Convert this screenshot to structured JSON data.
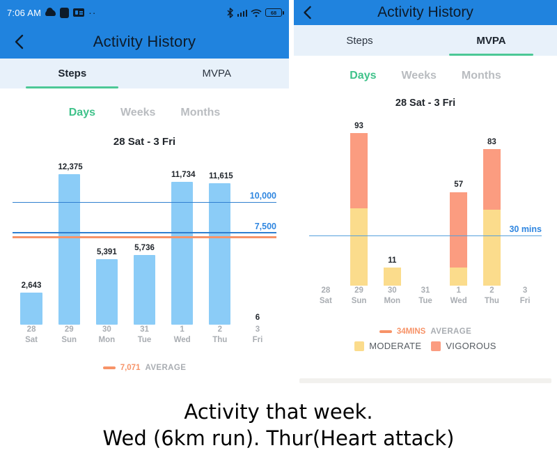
{
  "left_phone": {
    "status_bar": {
      "time": "7:06 AM",
      "icons": [
        "cloud-icon",
        "square-icon",
        "card-icon",
        "dots-icon"
      ],
      "right_icons": [
        "bluetooth-icon",
        "signal-icon",
        "wifi-icon",
        "battery-icon"
      ],
      "battery_level": "68"
    },
    "app_bar": {
      "title": "Activity History",
      "back": "back-chevron-icon"
    },
    "tabs": [
      {
        "label": "Steps",
        "active": true
      },
      {
        "label": "MVPA",
        "active": false
      }
    ],
    "periods": [
      {
        "label": "Days",
        "active": true
      },
      {
        "label": "Weeks",
        "active": false
      },
      {
        "label": "Months",
        "active": false
      }
    ],
    "range_title": "28 Sat  -  3 Fri",
    "legend": {
      "value": "7,071",
      "word": "AVERAGE"
    }
  },
  "right_phone": {
    "app_bar": {
      "title": "Activity History",
      "back": "back-chevron-icon"
    },
    "tabs": [
      {
        "label": "Steps",
        "active": false
      },
      {
        "label": "MVPA",
        "active": true
      }
    ],
    "periods": [
      {
        "label": "Days",
        "active": true
      },
      {
        "label": "Weeks",
        "active": false
      },
      {
        "label": "Months",
        "active": false
      }
    ],
    "range_title": "28 Sat  -  3 Fri",
    "legend_average": {
      "value": "34MINS",
      "word": "AVERAGE"
    },
    "legend_series": [
      {
        "label": "MODERATE",
        "color": "#FBDC8C"
      },
      {
        "label": "VIGOROUS",
        "color": "#FB9C80"
      }
    ]
  },
  "caption": {
    "line1": "Activity that week.",
    "line2": "Wed (6km run). Thur(Heart attack)"
  },
  "colors": {
    "header_blue": "#2083DE",
    "tabbar_bg": "#E8F1FA",
    "tab_accent_green": "#4CC896",
    "period_active_green": "#3FC28A",
    "bar_blue": "#8BCCF7",
    "goal_line_blue": "#2F7FD0",
    "average_orange": "#F79368",
    "moderate_yellow": "#FBDC8C",
    "vigorous_salmon": "#FB9C80"
  },
  "chart_data": [
    {
      "type": "bar",
      "title": "28 Sat  -  3 Fri",
      "subtitle": "Steps",
      "xlabel": "",
      "ylabel": "Steps",
      "ylim": [
        0,
        13500
      ],
      "grid": false,
      "legend_position": "bottom",
      "categories": [
        "28 Sat",
        "29 Sun",
        "30 Mon",
        "31 Tue",
        "1 Wed",
        "2 Thu",
        "3 Fri"
      ],
      "tick_day_numbers": [
        "28",
        "29",
        "30",
        "31",
        "1",
        "2",
        "3"
      ],
      "tick_day_names": [
        "Sat",
        "Sun",
        "Mon",
        "Tue",
        "Wed",
        "Thu",
        "Fri"
      ],
      "values": [
        2643,
        12375,
        5391,
        5736,
        11734,
        11615,
        6
      ],
      "data_labels": [
        "2,643",
        "12,375",
        "5,391",
        "5,736",
        "11,734",
        "11,615",
        "6"
      ],
      "bar_color": "#8BCCF7",
      "reference_lines": [
        {
          "label": "10,000",
          "value": 10000,
          "color": "#2F7FD0"
        },
        {
          "label": "7,500",
          "value": 7500,
          "color": "#2F7FD0"
        },
        {
          "label": "7,071 AVERAGE",
          "value": 7071,
          "color": "#F79368"
        }
      ]
    },
    {
      "type": "bar",
      "title": "28 Sat  -  3 Fri",
      "subtitle": "MVPA",
      "xlabel": "",
      "ylabel": "Minutes",
      "ylim": [
        0,
        100
      ],
      "grid": false,
      "stacked": true,
      "legend_position": "bottom",
      "categories": [
        "28 Sat",
        "29 Sun",
        "30 Mon",
        "31 Tue",
        "1 Wed",
        "2 Thu",
        "3 Fri"
      ],
      "tick_day_numbers": [
        "28",
        "29",
        "30",
        "31",
        "1",
        "2",
        "3"
      ],
      "tick_day_names": [
        "Sat",
        "Sun",
        "Mon",
        "Tue",
        "Wed",
        "Thu",
        "Fri"
      ],
      "totals": [
        0,
        93,
        11,
        0,
        57,
        83,
        0
      ],
      "data_labels": [
        "",
        "93",
        "11",
        "",
        "57",
        "83",
        ""
      ],
      "series": [
        {
          "name": "MODERATE",
          "color": "#FBDC8C",
          "values": [
            0,
            47,
            11,
            0,
            11,
            46,
            0
          ]
        },
        {
          "name": "VIGOROUS",
          "color": "#FB9C80",
          "values": [
            0,
            46,
            0,
            0,
            46,
            37,
            0
          ]
        }
      ],
      "reference_lines": [
        {
          "label": "30 mins",
          "value": 30,
          "color": "#55A0DC"
        },
        {
          "label": "34MINS AVERAGE",
          "value": 34,
          "color": "#F79368"
        }
      ]
    }
  ]
}
